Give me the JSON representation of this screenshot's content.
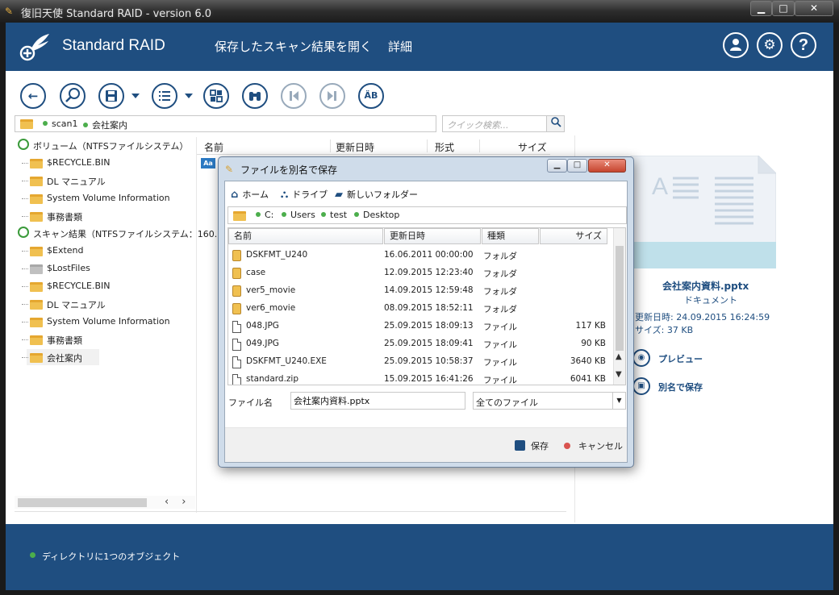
{
  "window": {
    "title": "復旧天使 Standard RAID - version 6.0",
    "min": "▁",
    "max": "□",
    "close": "✕"
  },
  "header": {
    "brand": "Standard RAID",
    "nav": {
      "open_scan": "保存したスキャン結果を開く",
      "detail": "詳細"
    },
    "icons": {
      "user": "person-icon",
      "settings": "gear-icon",
      "help": "?"
    }
  },
  "toolbar": {
    "buttons": [
      "back-icon",
      "search-icon",
      "save-icon",
      "view-list-icon",
      "grid-icon",
      "binoculars-icon",
      "prev-icon",
      "next-icon",
      "charset-icon"
    ],
    "charset_label": "ÄB"
  },
  "breadcrumb": {
    "items": [
      "scan1",
      "会社案内"
    ]
  },
  "search": {
    "placeholder": "クイック検索..."
  },
  "tree": {
    "volume": {
      "label": "ボリューム（NTFSファイルシステム）",
      "children": [
        "$RECYCLE.BIN",
        "DL マニュアル",
        "System Volume Information",
        "事務書類"
      ]
    },
    "scan": {
      "label": "スキャン結果（NTFSファイルシステム：160.",
      "children": [
        "$Extend",
        "$LostFiles",
        "$RECYCLE.BIN",
        "DL マニュアル",
        "System Volume Information",
        "事務書類",
        "会社案内"
      ]
    }
  },
  "list": {
    "columns": {
      "name": "名前",
      "modified": "更新日時",
      "format": "形式",
      "size": "サイズ"
    },
    "row_icon": "Aa"
  },
  "preview": {
    "file_name": "会社案内資料.pptx",
    "file_type": "ドキュメント",
    "modified": "更新日時: 24.09.2015 16:24:59",
    "size": "サイズ: 37 KB",
    "actions": {
      "preview": "プレビュー",
      "save_as": "別名で保存"
    }
  },
  "footer": {
    "status": "ディレクトリに1つのオブジェクト"
  },
  "dialog": {
    "title": "ファイルを別名で保存",
    "nav": {
      "home": "ホーム",
      "drive": "ドライブ",
      "new_folder": "新しいフォルダー"
    },
    "path": [
      "C:",
      "Users",
      "test",
      "Desktop"
    ],
    "columns": {
      "name": "名前",
      "modified": "更新日時",
      "type": "種類",
      "size": "サイズ"
    },
    "rows": [
      {
        "name": "DSKFMT_U240",
        "modified": "16.06.2011 00:00:00",
        "type": "フォルダ",
        "size": "",
        "kind": "folder"
      },
      {
        "name": "case",
        "modified": "12.09.2015 12:23:40",
        "type": "フォルダ",
        "size": "",
        "kind": "folder"
      },
      {
        "name": "ver5_movie",
        "modified": "14.09.2015 12:59:48",
        "type": "フォルダ",
        "size": "",
        "kind": "folder"
      },
      {
        "name": "ver6_movie",
        "modified": "08.09.2015 18:52:11",
        "type": "フォルダ",
        "size": "",
        "kind": "folder"
      },
      {
        "name": "048.JPG",
        "modified": "25.09.2015 18:09:13",
        "type": "ファイル",
        "size": "117 KB",
        "kind": "file"
      },
      {
        "name": "049.JPG",
        "modified": "25.09.2015 18:09:41",
        "type": "ファイル",
        "size": "90 KB",
        "kind": "file"
      },
      {
        "name": "DSKFMT_U240.EXE",
        "modified": "25.09.2015 10:58:37",
        "type": "ファイル",
        "size": "3640 KB",
        "kind": "file"
      },
      {
        "name": "standard.zip",
        "modified": "15.09.2015 16:41:26",
        "type": "ファイル",
        "size": "6041 KB",
        "kind": "file"
      }
    ],
    "filename_label": "ファイル名",
    "filename_value": "会社案内資料.pptx",
    "filetype": "全てのファイル",
    "save": "保存",
    "cancel": "キャンセル"
  },
  "colors": {
    "brand": "#1f4e80",
    "status_dot": "#4cae4c",
    "cancel_dot": "#d9534f"
  }
}
